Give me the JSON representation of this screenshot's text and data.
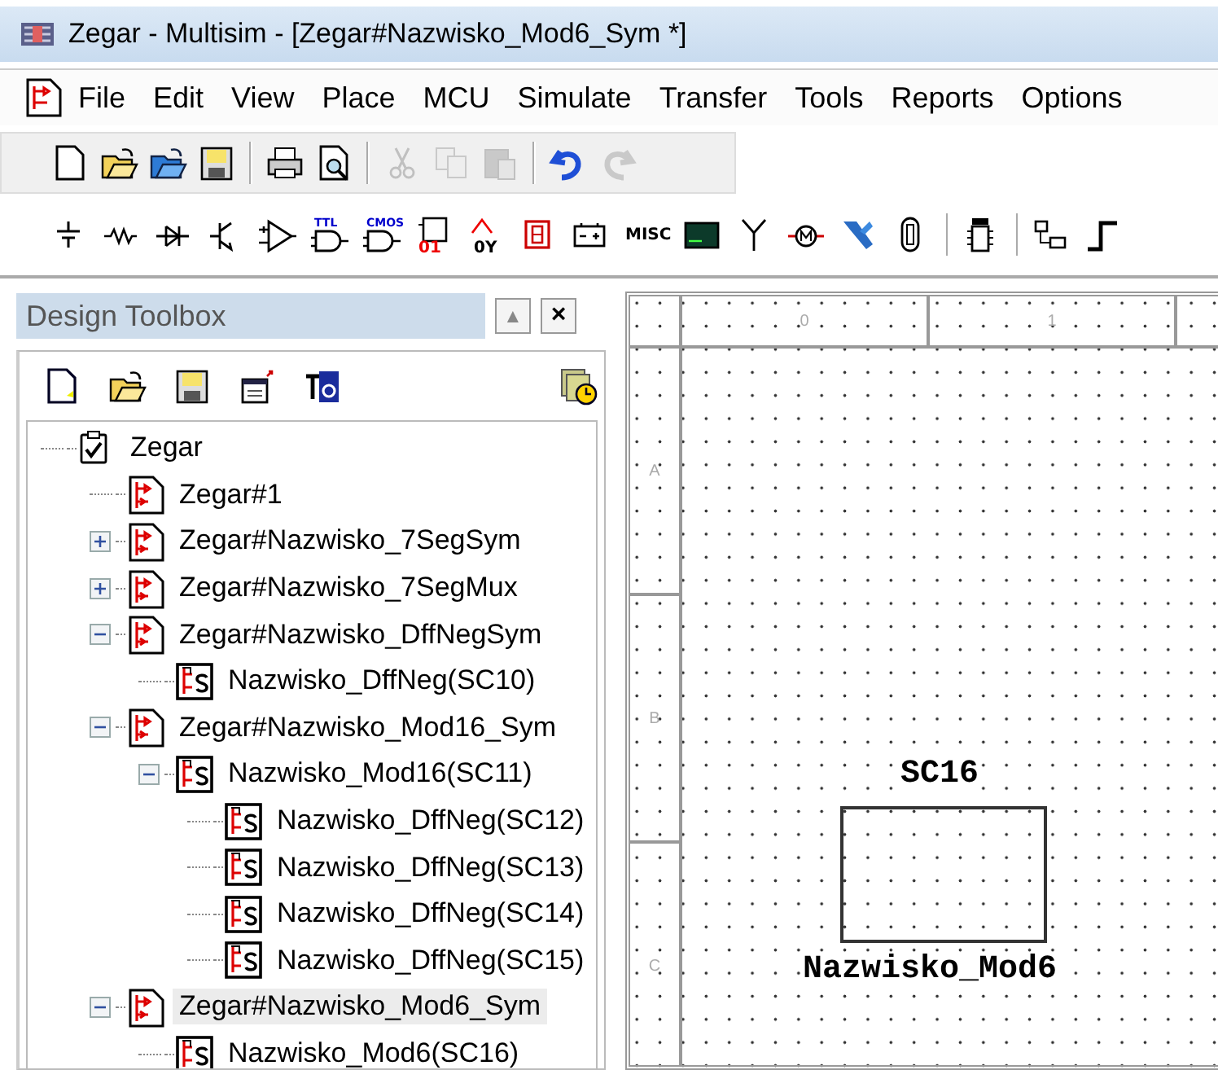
{
  "window": {
    "title": "Zegar - Multisim - [Zegar#Nazwisko_Mod6_Sym *]"
  },
  "menu": [
    {
      "label": "File"
    },
    {
      "label": "Edit"
    },
    {
      "label": "View"
    },
    {
      "label": "Place"
    },
    {
      "label": "MCU"
    },
    {
      "label": "Simulate"
    },
    {
      "label": "Transfer"
    },
    {
      "label": "Tools"
    },
    {
      "label": "Reports"
    },
    {
      "label": "Options"
    }
  ],
  "toolbar_main": [
    {
      "kind": "new",
      "disabled": false
    },
    {
      "kind": "open",
      "disabled": false
    },
    {
      "kind": "open-sample",
      "disabled": false
    },
    {
      "kind": "save",
      "disabled": false
    },
    {
      "kind": "separator"
    },
    {
      "kind": "print",
      "disabled": false
    },
    {
      "kind": "preview",
      "disabled": false
    },
    {
      "kind": "separator"
    },
    {
      "kind": "cut",
      "disabled": true
    },
    {
      "kind": "copy",
      "disabled": true
    },
    {
      "kind": "paste",
      "disabled": true
    },
    {
      "kind": "separator"
    },
    {
      "kind": "undo",
      "disabled": false
    },
    {
      "kind": "redo",
      "disabled": true
    }
  ],
  "toolbar_components": [
    {
      "kind": "source"
    },
    {
      "kind": "resistor"
    },
    {
      "kind": "diode"
    },
    {
      "kind": "transistor"
    },
    {
      "kind": "opamp"
    },
    {
      "kind": "gate",
      "label": "TTL"
    },
    {
      "kind": "gate",
      "label": "CMOS"
    },
    {
      "kind": "digital",
      "label": "01"
    },
    {
      "kind": "mixed",
      "label": "0Y"
    },
    {
      "kind": "display"
    },
    {
      "kind": "power"
    },
    {
      "kind": "text",
      "label": "MISC"
    },
    {
      "kind": "monitor"
    },
    {
      "kind": "antenna"
    },
    {
      "kind": "motor"
    },
    {
      "kind": "ni"
    },
    {
      "kind": "connector"
    },
    {
      "kind": "separator"
    },
    {
      "kind": "chip"
    },
    {
      "kind": "separator"
    },
    {
      "kind": "hierarchy"
    },
    {
      "kind": "step"
    }
  ],
  "design_toolbox": {
    "title": "Design Toolbox",
    "buttons": [
      "▲",
      "×"
    ],
    "toolbar": [
      {
        "kind": "new"
      },
      {
        "kind": "open"
      },
      {
        "kind": "save"
      },
      {
        "kind": "window"
      },
      {
        "kind": "text-box"
      },
      {
        "kind": "history"
      }
    ],
    "tree": [
      {
        "label": "Zegar",
        "kind": "project",
        "selected": false,
        "children": [
          {
            "label": "Zegar#1",
            "kind": "design",
            "selected": false
          },
          {
            "label": "Zegar#Nazwisko_7SegSym",
            "kind": "design",
            "selected": false,
            "expanded": false
          },
          {
            "label": "Zegar#Nazwisko_7SegMux",
            "kind": "design",
            "selected": false,
            "expanded": false
          },
          {
            "label": "Zegar#Nazwisko_DffNegSym",
            "kind": "design",
            "selected": false,
            "expanded": true,
            "children": [
              {
                "label": "Nazwisko_DffNeg(SC10)",
                "kind": "subcircuit",
                "selected": false
              }
            ]
          },
          {
            "label": "Zegar#Nazwisko_Mod16_Sym",
            "kind": "design",
            "selected": false,
            "expanded": true,
            "children": [
              {
                "label": "Nazwisko_Mod16(SC11)",
                "kind": "subcircuit",
                "selected": false,
                "expanded": true,
                "children": [
                  {
                    "label": "Nazwisko_DffNeg(SC12)",
                    "kind": "subcircuit",
                    "selected": false
                  },
                  {
                    "label": "Nazwisko_DffNeg(SC13)",
                    "kind": "subcircuit",
                    "selected": false
                  },
                  {
                    "label": "Nazwisko_DffNeg(SC14)",
                    "kind": "subcircuit",
                    "selected": false
                  },
                  {
                    "label": "Nazwisko_DffNeg(SC15)",
                    "kind": "subcircuit",
                    "selected": false
                  }
                ]
              }
            ]
          },
          {
            "label": "Zegar#Nazwisko_Mod6_Sym",
            "kind": "design",
            "selected": true,
            "expanded": true,
            "children": [
              {
                "label": "Nazwisko_Mod6(SC16)",
                "kind": "subcircuit",
                "selected": false
              }
            ]
          }
        ]
      }
    ]
  },
  "schematic": {
    "ruler_columns": [
      "0",
      "1"
    ],
    "ruler_rows": [
      "A",
      "B",
      "C"
    ],
    "components": [
      {
        "title": "SC16",
        "label": "Nazwisko_Mod6"
      }
    ]
  }
}
